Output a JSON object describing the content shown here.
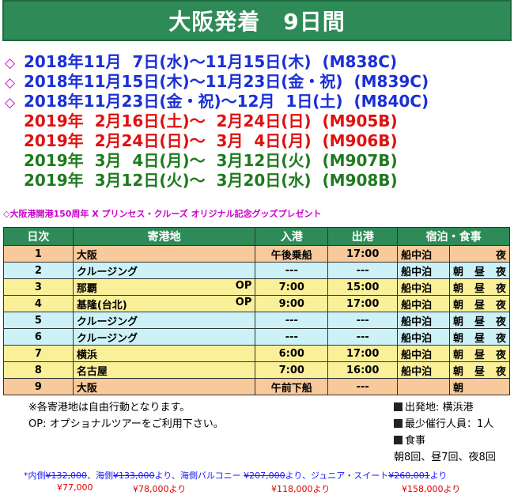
{
  "banner": {
    "title": "大阪発着　9日間"
  },
  "dates": [
    {
      "marker": "◇",
      "text": "2018年11月  7日(水)～11月15日(木)  (M838C)",
      "color": "#1a2fd6"
    },
    {
      "marker": "◇",
      "text": "2018年11月15日(木)～11月23日(金・祝)  (M839C)",
      "color": "#1a2fd6"
    },
    {
      "marker": "◇",
      "text": "2018年11月23日(金・祝)～12月  1日(土)  (M840C)",
      "color": "#1a2fd6"
    },
    {
      "marker": "",
      "text": "2019年  2月16日(土)～  2月24日(日)  (M905B)",
      "color": "#e01010"
    },
    {
      "marker": "",
      "text": "2019年  2月24日(日)～  3月  4日(月)  (M906B)",
      "color": "#e01010"
    },
    {
      "marker": "",
      "text": "2019年  3月  4日(月)～  3月12日(火)  (M907B)",
      "color": "#1e7a1e"
    },
    {
      "marker": "",
      "text": "2019年  3月12日(火)～  3月20日(水)  (M908B)",
      "color": "#1e7a1e"
    }
  ],
  "promo": "◇大阪港開港150周年 X プリンセス・クルーズ オリジナル記念グッズプレゼント",
  "itinerary": {
    "headers": {
      "day": "日次",
      "port": "寄港地",
      "arrive": "入港",
      "depart": "出港",
      "stay_meal": "宿泊・食事"
    },
    "rows": [
      {
        "day": "1",
        "port": "大阪",
        "op": "",
        "arrive": "午後乗船",
        "depart": "17:00",
        "stay": "船中泊",
        "m1": "",
        "m2": "",
        "m3": "夜",
        "bg": "#f8c99a"
      },
      {
        "day": "2",
        "port": "クルージング",
        "op": "",
        "arrive": "---",
        "depart": "---",
        "stay": "船中泊",
        "m1": "朝",
        "m2": "昼",
        "m3": "夜",
        "bg": "#ccf2f8"
      },
      {
        "day": "3",
        "port": "那覇",
        "op": "OP",
        "arrive": "7:00",
        "depart": "15:00",
        "stay": "船中泊",
        "m1": "朝",
        "m2": "昼",
        "m3": "夜",
        "bg": "#fbf09a"
      },
      {
        "day": "4",
        "port": "基隆(台北)",
        "op": "OP",
        "arrive": "9:00",
        "depart": "17:00",
        "stay": "船中泊",
        "m1": "朝",
        "m2": "昼",
        "m3": "夜",
        "bg": "#fbf09a"
      },
      {
        "day": "5",
        "port": "クルージング",
        "op": "",
        "arrive": "---",
        "depart": "---",
        "stay": "船中泊",
        "m1": "朝",
        "m2": "昼",
        "m3": "夜",
        "bg": "#ccf2f8"
      },
      {
        "day": "6",
        "port": "クルージング",
        "op": "",
        "arrive": "---",
        "depart": "---",
        "stay": "船中泊",
        "m1": "朝",
        "m2": "昼",
        "m3": "夜",
        "bg": "#ccf2f8"
      },
      {
        "day": "7",
        "port": "横浜",
        "op": "",
        "arrive": "6:00",
        "depart": "17:00",
        "stay": "船中泊",
        "m1": "朝",
        "m2": "昼",
        "m3": "夜",
        "bg": "#fbf09a"
      },
      {
        "day": "8",
        "port": "名古屋",
        "op": "",
        "arrive": "7:00",
        "depart": "16:00",
        "stay": "船中泊",
        "m1": "朝",
        "m2": "昼",
        "m3": "夜",
        "bg": "#fbf09a"
      },
      {
        "day": "9",
        "port": "大阪",
        "op": "",
        "arrive": "午前下船",
        "depart": "---",
        "stay": "",
        "m1": "朝",
        "m2": "",
        "m3": "",
        "bg": "#f8c99a"
      }
    ]
  },
  "notes": {
    "line1": "※各寄港地は自由行動となります。",
    "line2": "OP: オプショナルツアーをご利用下さい。"
  },
  "info": {
    "departure": "出発地:  横浜港",
    "min_people": "最少催行人員：1人",
    "meals_label": "食事",
    "meals_count": "朝8回、昼7回、夜8回"
  },
  "prices": {
    "lead": "*内側",
    "inside_old": "¥132,000",
    "sep1": "、海側",
    "ocean_old": "¥133,000",
    "sep2": "より、海側バルコニー ",
    "balcony_old": "¥207,000",
    "sep3": "より、ジュニア・スイート",
    "suite_old": "¥260,001",
    "tail": "より",
    "inside_new": "¥77,000",
    "ocean_new": "¥78,000より",
    "balcony_new": "¥118,000より",
    "suite_new": "¥158,000より"
  }
}
